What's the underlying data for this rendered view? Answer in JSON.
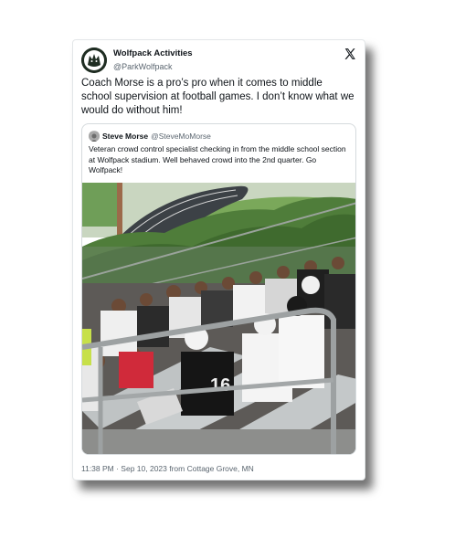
{
  "tweet": {
    "display_name": "Wolfpack Activities",
    "handle": "@ParkWolfpack",
    "text": "Coach Morse is a pro’s pro when it comes to middle school supervision at football games. I don’t know what we would do without him!",
    "footer": "11:38 PM · Sep 10, 2023 from Cottage Grove, MN"
  },
  "quoted": {
    "display_name": "Steve Morse",
    "handle": "@SteveMoMorse",
    "text": "Veteran crowd control specialist checking in from the middle school section at Wolfpack stadium.  Well behaved crowd into the 2nd quarter.  Go Wolfpack!",
    "photo_icon": "crowd-on-bleachers-photo"
  },
  "icons": {
    "platform": "x-logo-icon",
    "avatar": "wolf-logo-avatar"
  },
  "colors": {
    "text_primary": "#0f1419",
    "text_secondary": "#5b6670",
    "border": "#d5dadd"
  }
}
